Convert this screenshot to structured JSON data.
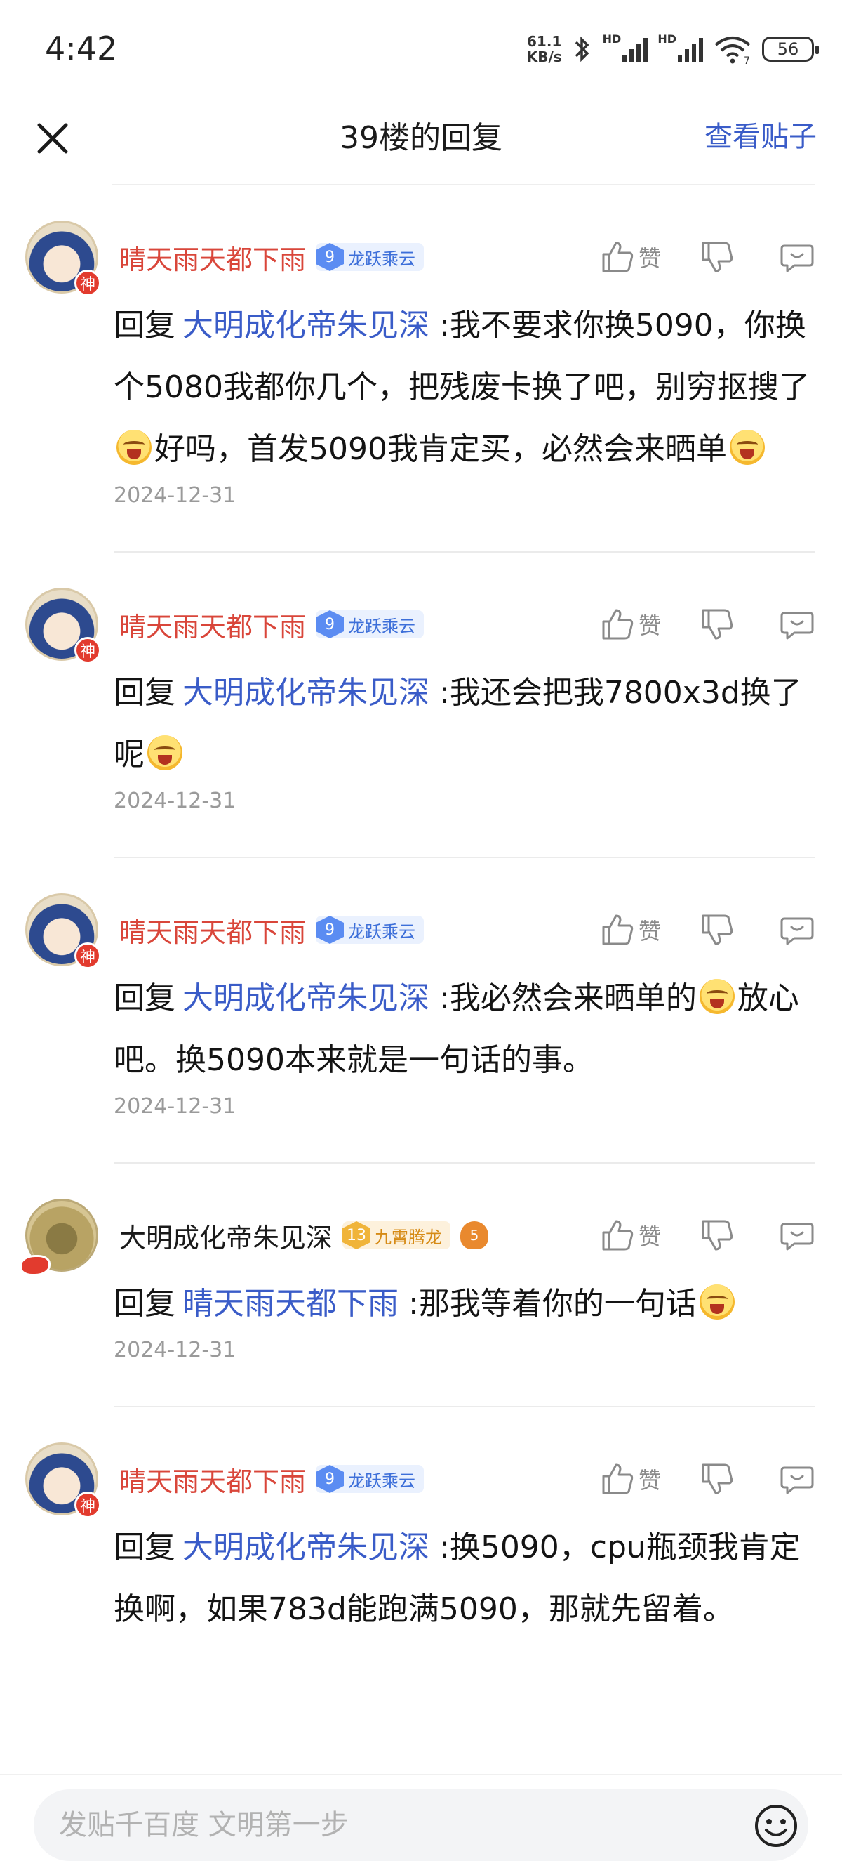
{
  "status_bar": {
    "time": "4:42",
    "net_speed_value": "61.1",
    "net_speed_unit": "KB/s",
    "hd1": "HD",
    "hd2": "HD",
    "wifi_label": "7",
    "battery": "56"
  },
  "nav": {
    "title": "39楼的回复",
    "view_post": "查看贴子"
  },
  "comments": [
    {
      "username": "晴天雨天都下雨",
      "level": "9",
      "level_name": "龙跃乘云",
      "reply_word": "回复",
      "reply_target": "大明成化帝朱见深",
      "text_1": ":我不要求你换5090，你换个5080我都你几个，把残废卡换了吧，别穷抠搜了",
      "text_2": "好吗，首发5090我肯定买，必然会来晒单",
      "date": "2024-12-31",
      "like_label": "赞",
      "avatar_badge": "神"
    },
    {
      "username": "晴天雨天都下雨",
      "level": "9",
      "level_name": "龙跃乘云",
      "reply_word": "回复",
      "reply_target": "大明成化帝朱见深",
      "text_1": ":我还会把我7800x3d换了呢",
      "date": "2024-12-31",
      "like_label": "赞",
      "avatar_badge": "神"
    },
    {
      "username": "晴天雨天都下雨",
      "level": "9",
      "level_name": "龙跃乘云",
      "reply_word": "回复",
      "reply_target": "大明成化帝朱见深",
      "text_1": ":我必然会来晒单的",
      "text_2": "放心吧。换5090本来就是一句话的事。",
      "date": "2024-12-31",
      "like_label": "赞",
      "avatar_badge": "神"
    },
    {
      "username": "大明成化帝朱见深",
      "level": "13",
      "level_name": "九霄腾龙",
      "extra_badge": "5",
      "reply_word": "回复",
      "reply_target": "晴天雨天都下雨",
      "text_1": ":那我等着你的一句话",
      "date": "2024-12-31",
      "like_label": "赞"
    },
    {
      "username": "晴天雨天都下雨",
      "level": "9",
      "level_name": "龙跃乘云",
      "reply_word": "回复",
      "reply_target": "大明成化帝朱见深",
      "text_1": ":换5090，cpu瓶颈我肯定换啊，如果783d能跑满5090，那就先留着。",
      "like_label": "赞",
      "avatar_badge": "神"
    }
  ],
  "composer": {
    "placeholder": "发贴千百度 文明第一步"
  },
  "icons": {
    "close": "close-icon",
    "like": "thumbs-up-icon",
    "dislike": "thumbs-down-icon",
    "comment": "comment-bubble-icon",
    "emoji": "smiley-icon"
  },
  "colors": {
    "link_blue": "#3a5cc8",
    "username_red": "#d9463a",
    "level_blue": "#5b8cf2",
    "level_gold": "#f0b43a"
  }
}
